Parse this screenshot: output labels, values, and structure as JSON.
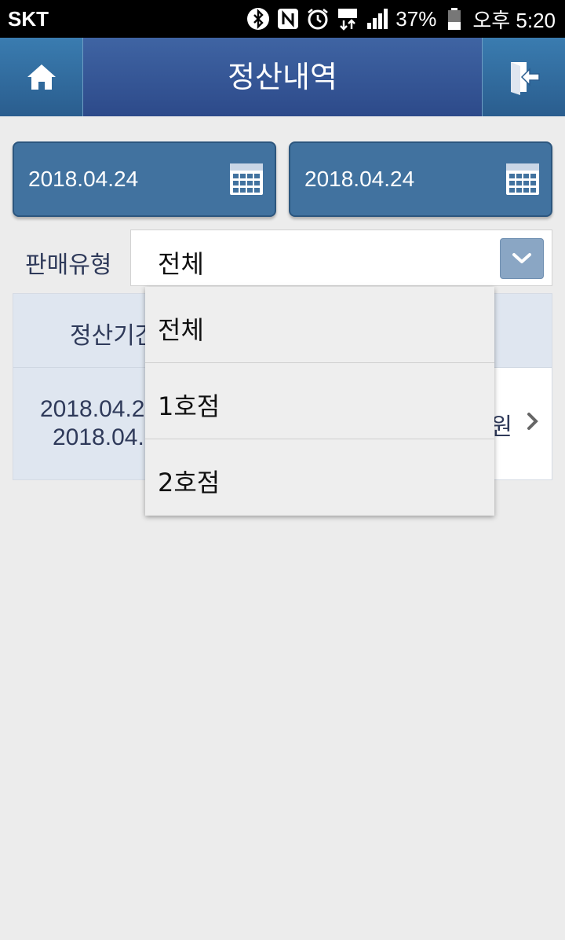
{
  "status_bar": {
    "carrier": "SKT",
    "battery": "37%",
    "time": "오후 5:20",
    "icons": [
      "bluetooth-icon",
      "nfc-icon",
      "alarm-icon",
      "lte-icon",
      "signal-icon",
      "battery-icon"
    ]
  },
  "header": {
    "title": "정산내역",
    "left_icon": "home-icon",
    "right_icon": "logout-icon"
  },
  "date_range": {
    "start": "2018.04.24",
    "end": "2018.04.24"
  },
  "sales_type": {
    "label": "판매유형",
    "selected": "전체",
    "options": [
      "전체",
      "1호점",
      "2호점"
    ]
  },
  "table": {
    "header_visible": "정산기간",
    "row": {
      "date_line1_visible": "2018.04.2",
      "date_line2_visible": "2018.04.",
      "amount_visible": "원"
    }
  },
  "colors": {
    "appbar": "#2d4a8a",
    "date_button": "#41729f",
    "table_header": "#dfe6f0",
    "text_dark": "#2f3a5a"
  }
}
